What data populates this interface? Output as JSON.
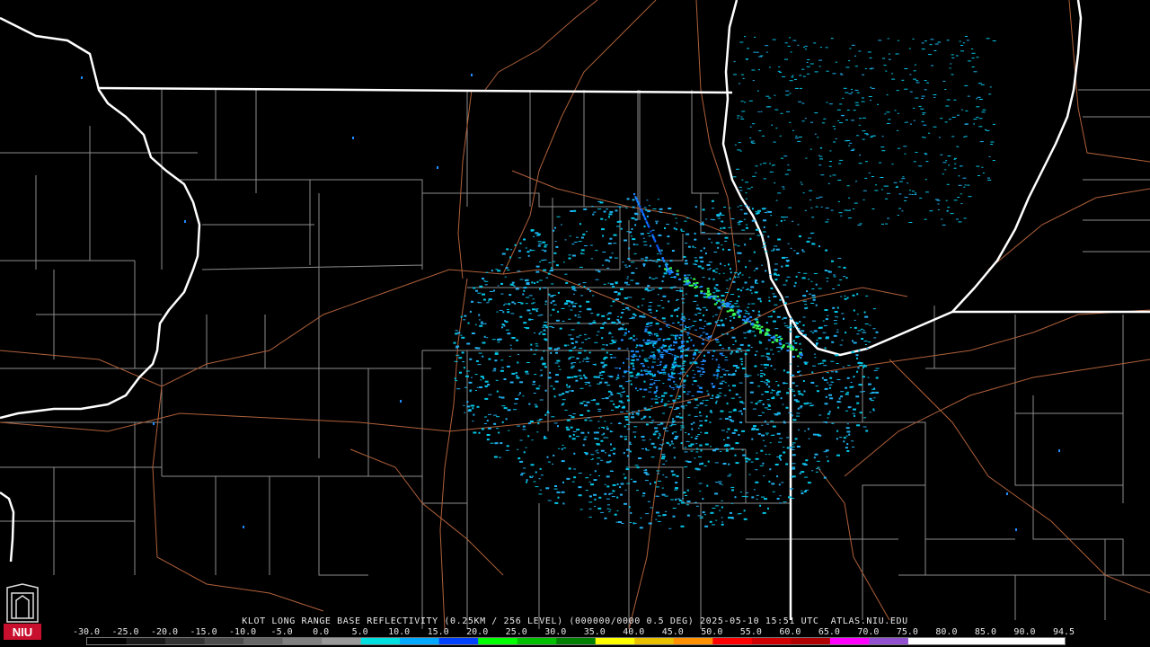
{
  "product": {
    "title": "KLOT LONG RANGE BASE REFLECTIVITY (0.25KM / 256 LEVEL) (000000/0000 0.5 DEG) 2025-05-10 15:51 UTC  ATLAS.NIU.EDU"
  },
  "colorbar": {
    "labels": [
      "-30.0",
      "-25.0",
      "-20.0",
      "-15.0",
      "-10.0",
      "-5.0",
      "0.0",
      "5.0",
      "10.0",
      "15.0",
      "20.0",
      "25.0",
      "30.0",
      "35.0",
      "40.0",
      "45.0",
      "50.0",
      "55.0",
      "60.0",
      "65.0",
      "70.0",
      "75.0",
      "80.0",
      "85.0",
      "90.0",
      "94.5"
    ],
    "colors": [
      "#000000",
      "#1a1a1a",
      "#333333",
      "#4d4d4d",
      "#666666",
      "#808080",
      "#9a9a9a",
      "#00e0e0",
      "#00a8ff",
      "#0040ff",
      "#00ff00",
      "#00c000",
      "#008000",
      "#ffff00",
      "#e8c000",
      "#ff9000",
      "#ff0000",
      "#d00000",
      "#b00000",
      "#ff00ff",
      "#9050d0",
      "#ffffff",
      "#ffffff",
      "#ffffff",
      "#ffffff"
    ]
  },
  "logo": {
    "text": "NIU",
    "color": "#c8102e"
  },
  "map": {
    "state_border_color": "#ffffff",
    "county_line_color": "#8c8c8c",
    "road_color": "#b0603a",
    "echo_colors": [
      "#00c8e8",
      "#1e8cff",
      "#22b0f0",
      "#3cff50",
      "#0050ff"
    ]
  }
}
